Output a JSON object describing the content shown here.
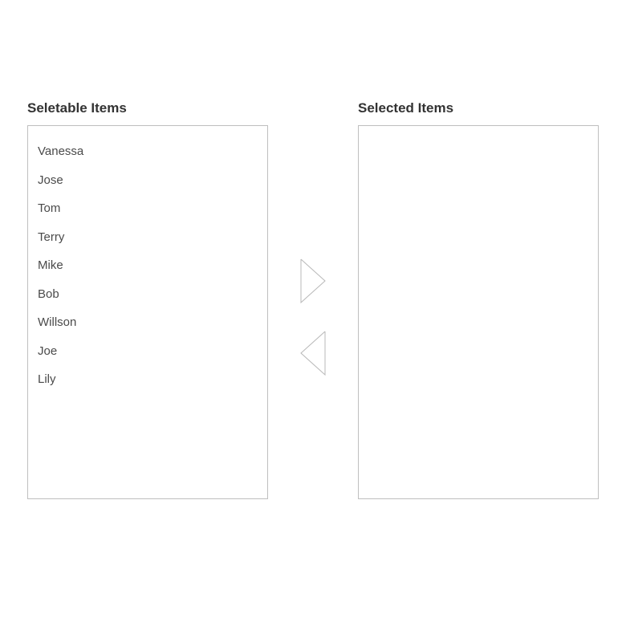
{
  "left": {
    "heading": "Seletable Items",
    "items": [
      "Vanessa",
      "Jose",
      "Tom",
      "Terry",
      "Mike",
      "Bob",
      "Willson",
      "Joe",
      "Lily"
    ]
  },
  "right": {
    "heading": "Selected Items",
    "items": []
  }
}
